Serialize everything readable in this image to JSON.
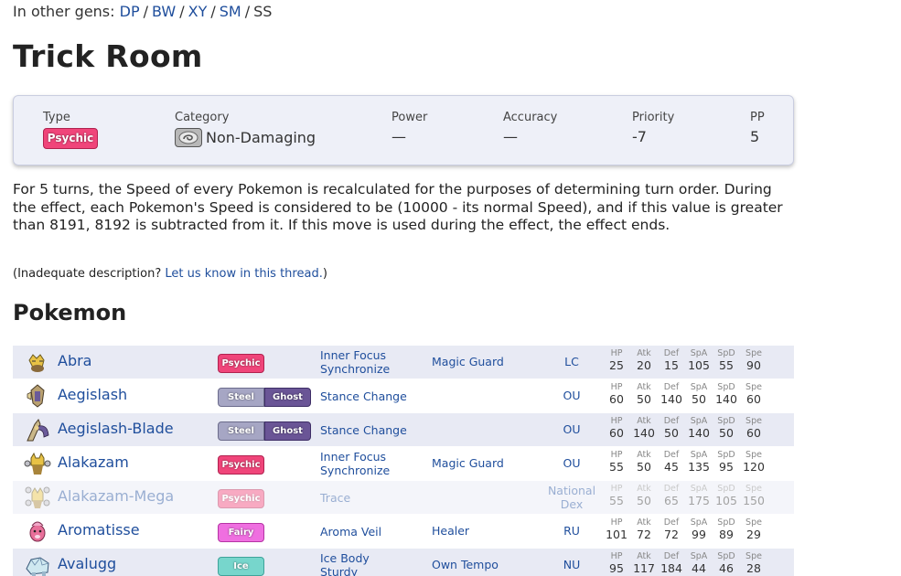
{
  "gens": {
    "prefix": "In other gens:",
    "links": [
      "DP",
      "BW",
      "XY",
      "SM"
    ],
    "current": "SS"
  },
  "move": {
    "name": "Trick Room",
    "type_label": "Type",
    "type": "Psychic",
    "category_label": "Category",
    "category": "Non-Damaging",
    "power_label": "Power",
    "power": "—",
    "accuracy_label": "Accuracy",
    "accuracy": "—",
    "priority_label": "Priority",
    "priority": "-7",
    "pp_label": "PP",
    "pp": "5"
  },
  "description": "For 5 turns, the Speed of every Pokemon is recalculated for the purposes of determining turn order. During the effect, each Pokemon's Speed is considered to be (10000 - its normal Speed), and if this value is greater than 8191, 8192 is subtracted from it. If this move is used during the effect, the effect ends.",
  "note": {
    "prefix": "(Inadequate description?",
    "link": "Let us know in this thread.",
    "suffix": ")"
  },
  "section_title": "Pokemon",
  "stat_headers": [
    "HP",
    "Atk",
    "Def",
    "SpA",
    "SpD",
    "Spe"
  ],
  "colors": {
    "Psychic": "#f0457a",
    "Steel": "#a6a6c4",
    "Ghost": "#6a5596",
    "Fairy": "#ef6fe0",
    "Ice": "#77d6cc"
  },
  "pokemon": [
    {
      "name": "Abra",
      "types": [
        "Psychic"
      ],
      "abilities": [
        "Inner Focus",
        "Synchronize"
      ],
      "hidden": "Magic Guard",
      "tier": [
        "LC"
      ],
      "stats": [
        25,
        20,
        15,
        105,
        55,
        90
      ],
      "sprite": "abra-sprite-icon"
    },
    {
      "name": "Aegislash",
      "types": [
        "Steel",
        "Ghost"
      ],
      "abilities": [
        "Stance Change"
      ],
      "hidden": "",
      "tier": [
        "OU"
      ],
      "stats": [
        60,
        50,
        140,
        50,
        140,
        60
      ],
      "sprite": "aegislash-sprite-icon"
    },
    {
      "name": "Aegislash-Blade",
      "types": [
        "Steel",
        "Ghost"
      ],
      "abilities": [
        "Stance Change"
      ],
      "hidden": "",
      "tier": [
        "OU"
      ],
      "stats": [
        60,
        140,
        50,
        140,
        50,
        60
      ],
      "sprite": "aegislash-blade-sprite-icon"
    },
    {
      "name": "Alakazam",
      "types": [
        "Psychic"
      ],
      "abilities": [
        "Inner Focus",
        "Synchronize"
      ],
      "hidden": "Magic Guard",
      "tier": [
        "OU"
      ],
      "stats": [
        55,
        50,
        45,
        135,
        95,
        120
      ],
      "sprite": "alakazam-sprite-icon"
    },
    {
      "name": "Alakazam-Mega",
      "types": [
        "Psychic"
      ],
      "abilities": [
        "Trace"
      ],
      "hidden": "",
      "tier": [
        "National",
        "Dex"
      ],
      "stats": [
        55,
        50,
        65,
        175,
        105,
        150
      ],
      "sprite": "alakazam-mega-sprite-icon",
      "faded": true
    },
    {
      "name": "Aromatisse",
      "types": [
        "Fairy"
      ],
      "abilities": [
        "Aroma Veil"
      ],
      "hidden": "Healer",
      "tier": [
        "RU"
      ],
      "stats": [
        101,
        72,
        72,
        99,
        89,
        29
      ],
      "sprite": "aromatisse-sprite-icon"
    },
    {
      "name": "Avalugg",
      "types": [
        "Ice"
      ],
      "abilities": [
        "Ice Body",
        "Sturdy"
      ],
      "hidden": "Own Tempo",
      "tier": [
        "NU"
      ],
      "stats": [
        95,
        117,
        184,
        44,
        46,
        28
      ],
      "sprite": "avalugg-sprite-icon"
    }
  ]
}
